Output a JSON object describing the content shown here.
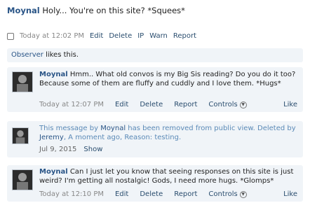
{
  "post": {
    "author": "Moynal",
    "text": "Holy... You're on this site? *Squees*",
    "time": "Today at 12:02 PM",
    "actions": [
      "Edit",
      "Delete",
      "IP",
      "Warn",
      "Report"
    ]
  },
  "likes": {
    "user": "Observer",
    "text": "likes this."
  },
  "comments": [
    {
      "author": "Moynal",
      "text": "Hmm.. What old convos is my Big Sis reading? Do you do it too? Because some of them are fluffy and cuddly and I love them. *Hugs*",
      "time": "Today at 12:07 PM",
      "edit": "Edit",
      "delete": "Delete",
      "report": "Report",
      "controls": "Controls",
      "like": "Like"
    },
    {
      "removed_prefix": "This message by",
      "author": "Moynal",
      "removed_mid": "has been removed from public view. Deleted by",
      "deleted_by": "Jeremy",
      "removed_suffix": ", A moment ago, Reason: testing.",
      "date": "Jul 9, 2015",
      "show": "Show"
    },
    {
      "author": "Moynal",
      "text": "Can I just let you know that seeing responses on this site is just weird? I'm getting all nostalgic! Gods, I need more hugs. *Glomps*",
      "time": "Today at 12:10 PM",
      "edit": "Edit",
      "delete": "Delete",
      "report": "Report",
      "controls": "Controls",
      "like": "Like"
    }
  ],
  "icons": {
    "controls": "chevron-down-icon",
    "checkbox": "checkbox-icon",
    "avatar": "avatar-image"
  }
}
